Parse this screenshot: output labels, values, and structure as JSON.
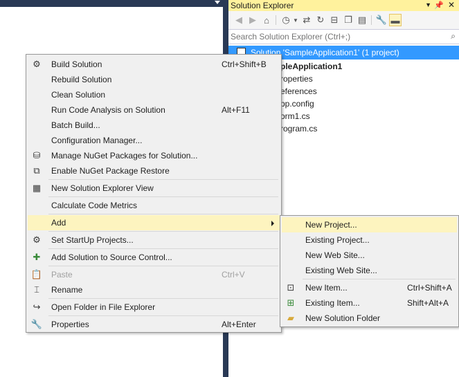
{
  "solution_explorer": {
    "title": "Solution Explorer",
    "search_placeholder": "Search Solution Explorer (Ctrl+;)",
    "tree": [
      {
        "label": "Solution 'SampleApplication1' (1 project)"
      },
      {
        "label": "pleApplication1"
      },
      {
        "label": "roperties"
      },
      {
        "label": "eferences"
      },
      {
        "label": "pp.config"
      },
      {
        "label": "orm1.cs"
      },
      {
        "label": "rogram.cs"
      }
    ]
  },
  "context_menu": {
    "items": [
      {
        "label": "Build Solution",
        "shortcut": "Ctrl+Shift+B"
      },
      {
        "label": "Rebuild Solution",
        "shortcut": ""
      },
      {
        "label": "Clean Solution",
        "shortcut": ""
      },
      {
        "label": "Run Code Analysis on Solution",
        "shortcut": "Alt+F11"
      },
      {
        "label": "Batch Build...",
        "shortcut": ""
      },
      {
        "label": "Configuration Manager...",
        "shortcut": ""
      },
      {
        "label": "Manage NuGet Packages for Solution...",
        "shortcut": ""
      },
      {
        "label": "Enable NuGet Package Restore",
        "shortcut": ""
      },
      {
        "label": "New Solution Explorer View",
        "shortcut": ""
      },
      {
        "label": "Calculate Code Metrics",
        "shortcut": ""
      },
      {
        "label": "Add",
        "shortcut": ""
      },
      {
        "label": "Set StartUp Projects...",
        "shortcut": ""
      },
      {
        "label": "Add Solution to Source Control...",
        "shortcut": ""
      },
      {
        "label": "Paste",
        "shortcut": "Ctrl+V"
      },
      {
        "label": "Rename",
        "shortcut": ""
      },
      {
        "label": "Open Folder in File Explorer",
        "shortcut": ""
      },
      {
        "label": "Properties",
        "shortcut": "Alt+Enter"
      }
    ]
  },
  "add_submenu": {
    "items": [
      {
        "label": "New Project...",
        "shortcut": ""
      },
      {
        "label": "Existing Project...",
        "shortcut": ""
      },
      {
        "label": "New Web Site...",
        "shortcut": ""
      },
      {
        "label": "Existing Web Site...",
        "shortcut": ""
      },
      {
        "label": "New Item...",
        "shortcut": "Ctrl+Shift+A"
      },
      {
        "label": "Existing Item...",
        "shortcut": "Shift+Alt+A"
      },
      {
        "label": "New Solution Folder",
        "shortcut": ""
      }
    ]
  },
  "colors": {
    "highlight": "#fdf4bf",
    "selection": "#3399ff",
    "title_active": "#fff29d",
    "frame": "#293955"
  }
}
